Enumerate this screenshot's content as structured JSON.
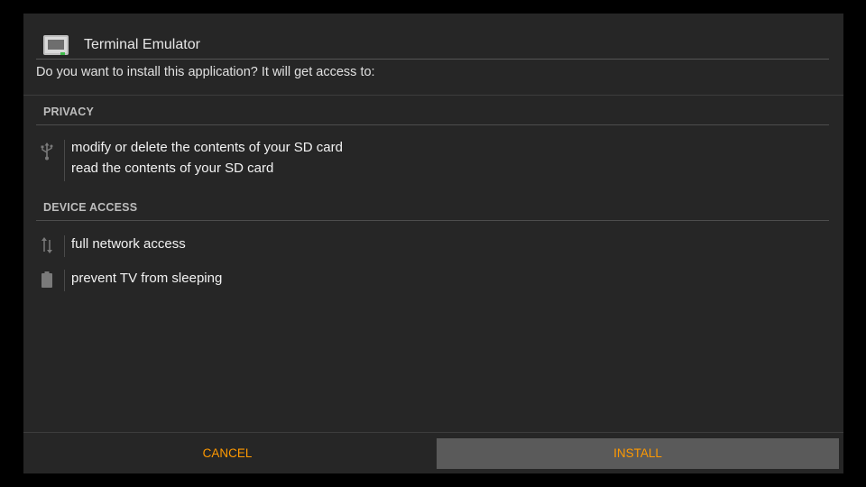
{
  "dialog": {
    "app_title": "Terminal Emulator",
    "prompt": "Do you want to install this application? It will get access to:"
  },
  "sections": [
    {
      "title": "PRIVACY",
      "groups": [
        {
          "icon": "usb-icon",
          "lines": [
            "modify or delete the contents of your SD card",
            "read the contents of your SD card"
          ]
        }
      ]
    },
    {
      "title": "DEVICE ACCESS",
      "groups": [
        {
          "icon": "network-arrows-icon",
          "lines": [
            "full network access"
          ]
        },
        {
          "icon": "battery-icon",
          "lines": [
            "prevent TV from sleeping"
          ]
        }
      ]
    }
  ],
  "buttons": {
    "cancel": "CANCEL",
    "install": "INSTALL"
  },
  "colors": {
    "accent": "#ff9900",
    "dialog_bg": "#262626",
    "install_bg": "#5a5a5a"
  }
}
